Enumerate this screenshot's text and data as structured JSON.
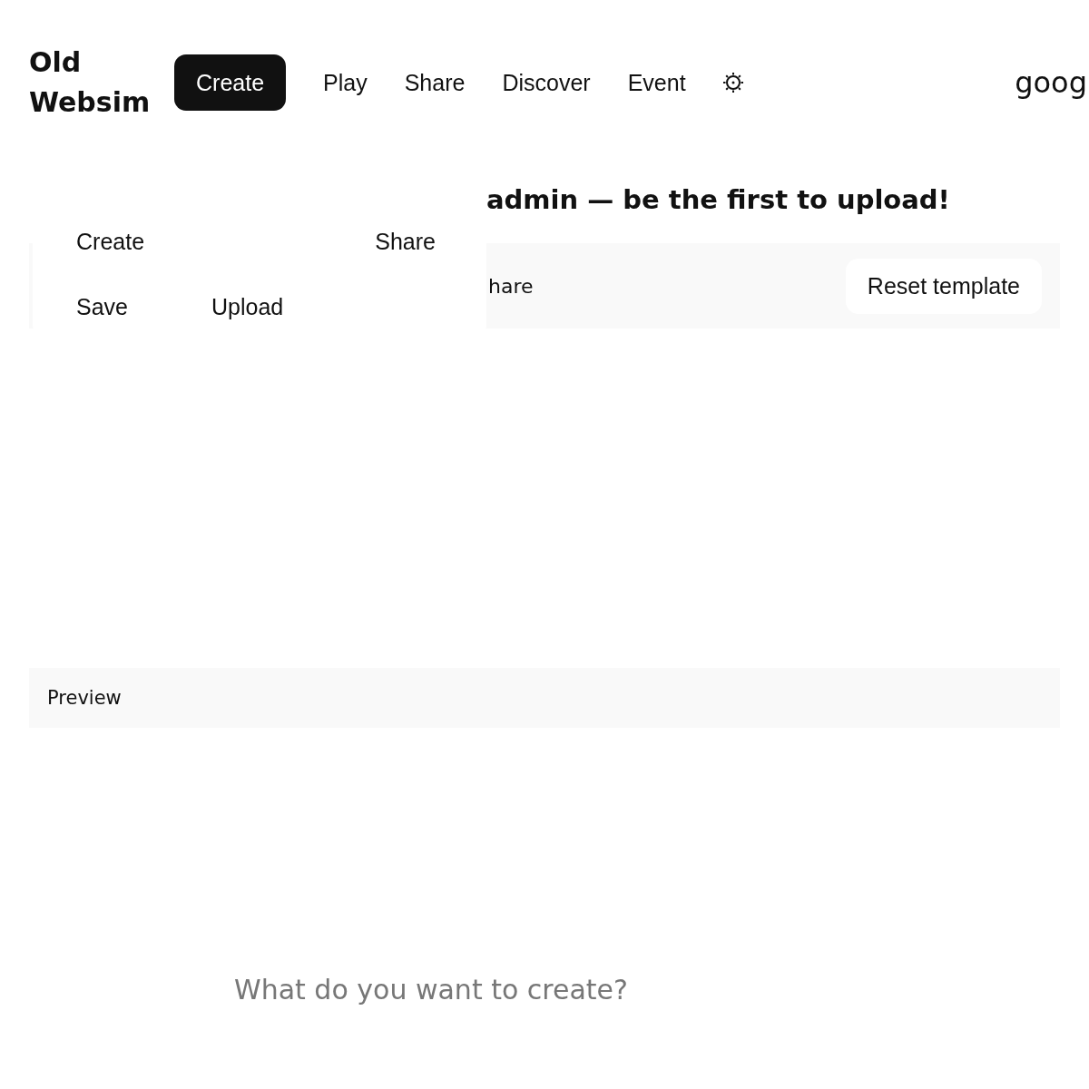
{
  "logo": "Old Websim",
  "nav": [
    {
      "label": "Create",
      "selected": true
    },
    {
      "label": "Play",
      "selected": false
    },
    {
      "label": "Share",
      "selected": false
    },
    {
      "label": "Discover",
      "selected": false
    },
    {
      "label": "Event",
      "selected": false
    }
  ],
  "account": "goog",
  "heading": "admin — be the first to upload!",
  "toolbar": {
    "label": "hare",
    "reset_button": "Reset template"
  },
  "menu": {
    "rows": [
      {
        "items": [
          "Create",
          "Share"
        ]
      },
      {
        "items": [
          "Save",
          "Upload"
        ]
      }
    ]
  },
  "preview": {
    "label": "Preview"
  },
  "prompt": {
    "placeholder": "What do you want to create?"
  }
}
